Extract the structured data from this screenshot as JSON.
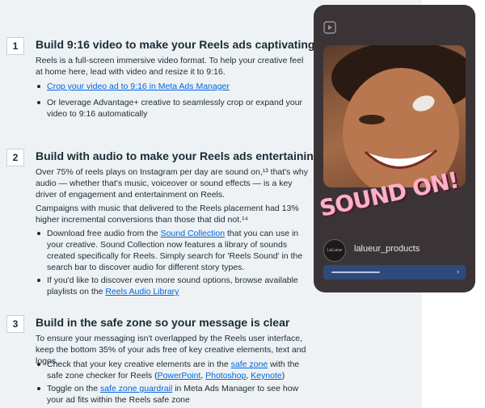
{
  "steps": [
    {
      "num": "1",
      "title": "Build 9:16 video to make your Reels ads captivating",
      "para": "Reels is a full-screen immersive video format. To help your creative feel at home here, lead with video and resize it to 9:16.",
      "b1_link": "Crop your video ad to 9:16 in Meta Ads Manager",
      "b2": "Or leverage Advantage+ creative to seamlessly crop or expand your video to 9:16 automatically"
    },
    {
      "num": "2",
      "title": "Build with audio to make your Reels ads entertaining",
      "para1": "Over 75% of reels plays on Instagram per day are sound on,¹³ that's why audio — whether that's music, voiceover or sound effects — is a key driver of engagement and entertainment on Reels.",
      "para2": "Campaigns with music that delivered to the Reels placement had 13% higher incremental conversions than those that did not.¹⁴",
      "b1_pre": "Download free audio from the ",
      "b1_link": "Sound Collection",
      "b1_post": " that you can use in your creative. Sound Collection now features a library of sounds created specifically for Reels. Simply search for 'Reels Sound' in the search bar to discover audio for different story types.",
      "b2_pre": "If you'd like to discover even more sound options, browse available playlists on the ",
      "b2_link": "Reels Audio Library"
    },
    {
      "num": "3",
      "title": "Build in the safe zone so your message is clear",
      "para": "To ensure your messaging isn't overlapped by the Reels user interface, keep the bottom 35% of your ads free of key creative elements, text and logos.",
      "b1_pre": "Check that your key creative elements are in the ",
      "b1_link": "safe zone",
      "b1_mid": " with the safe zone checker for Reels (",
      "b1_l2": "PowerPoint",
      "b1_s1": ", ",
      "b1_l3": "Photoshop",
      "b1_s2": ", ",
      "b1_l4": "Keynote",
      "b1_end": ")",
      "b2_pre": "Toggle on the ",
      "b2_link": "safe zone guardrail",
      "b2_post": " in Meta Ads Manager to see how your ad fits within the Reels safe zone"
    }
  ],
  "phone": {
    "sticker": "SOUND ON!",
    "avatar_text": "LaLueur",
    "handle": "lalueur_products",
    "cta_arrow": "›",
    "icon": "reels-play-icon"
  }
}
